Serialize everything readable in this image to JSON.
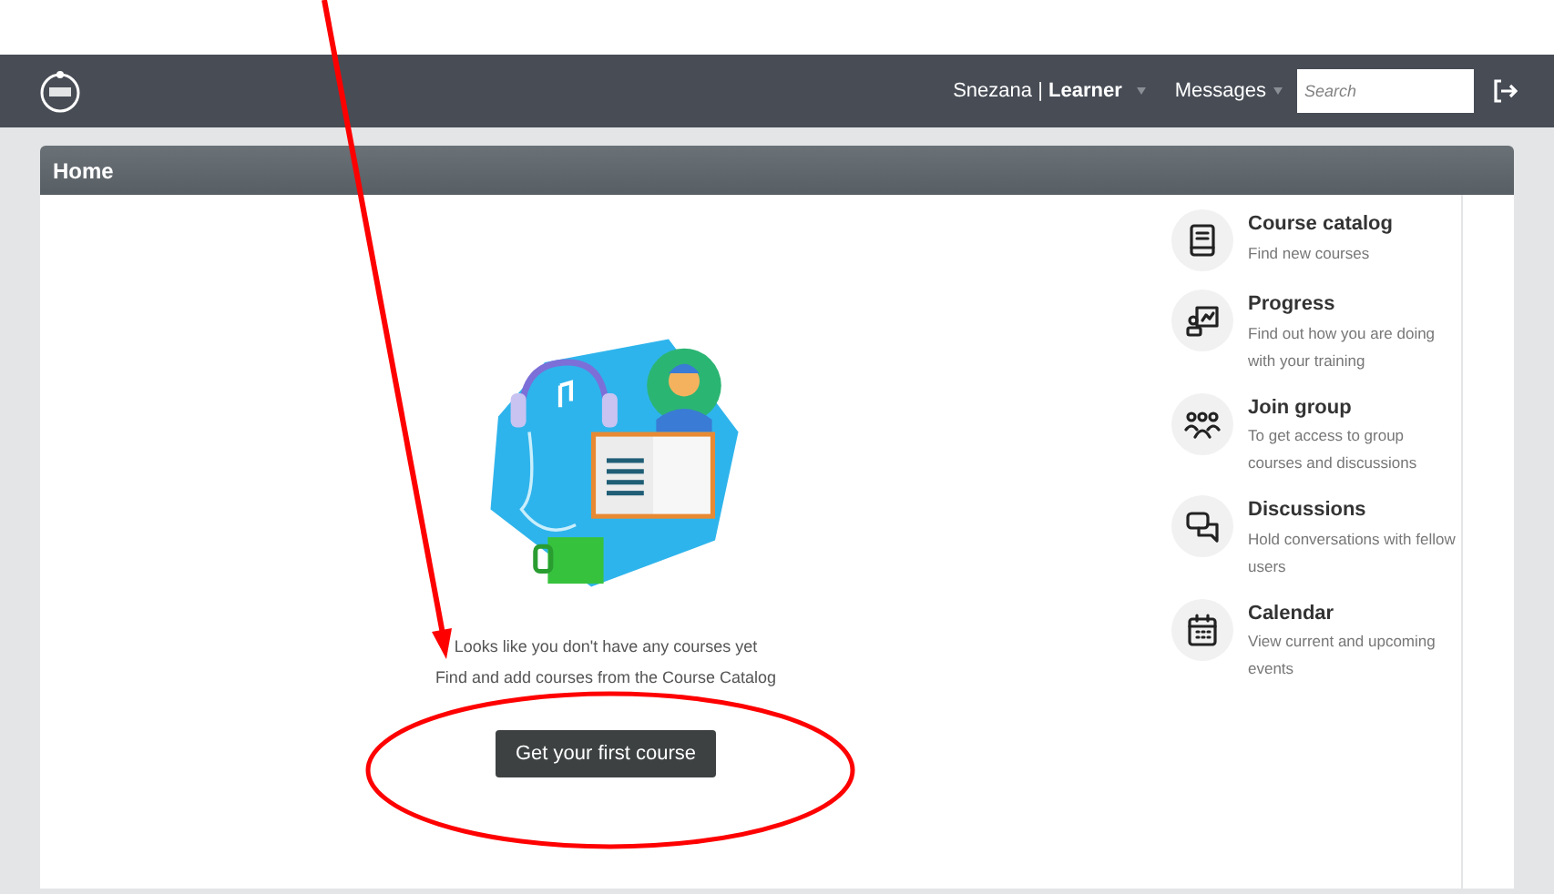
{
  "navbar": {
    "user": "Snezana | **Learner**",
    "messages": "Messages",
    "search": {
      "placeholder": "Search"
    }
  },
  "panel": {
    "title": "Home"
  },
  "empty_state": {
    "line_1": "Looks like you don't have any courses yet",
    "line_2": "Find and add courses from the Course Catalog",
    "button": "Get your first course"
  },
  "shortcuts": [
    {
      "kind": "catalog",
      "title": "Course catalog",
      "description": "Find new courses"
    },
    {
      "kind": "progress",
      "title": "Progress",
      "description": "Find out how you are doing with your training"
    },
    {
      "kind": "group",
      "title": "Join group",
      "description": "To get access to group courses and discussions"
    },
    {
      "kind": "discussions",
      "title": "Discussions",
      "description": "Hold conversations with fellow users"
    },
    {
      "kind": "calendar",
      "title": "Calendar",
      "description": "View current and upcoming events"
    }
  ]
}
